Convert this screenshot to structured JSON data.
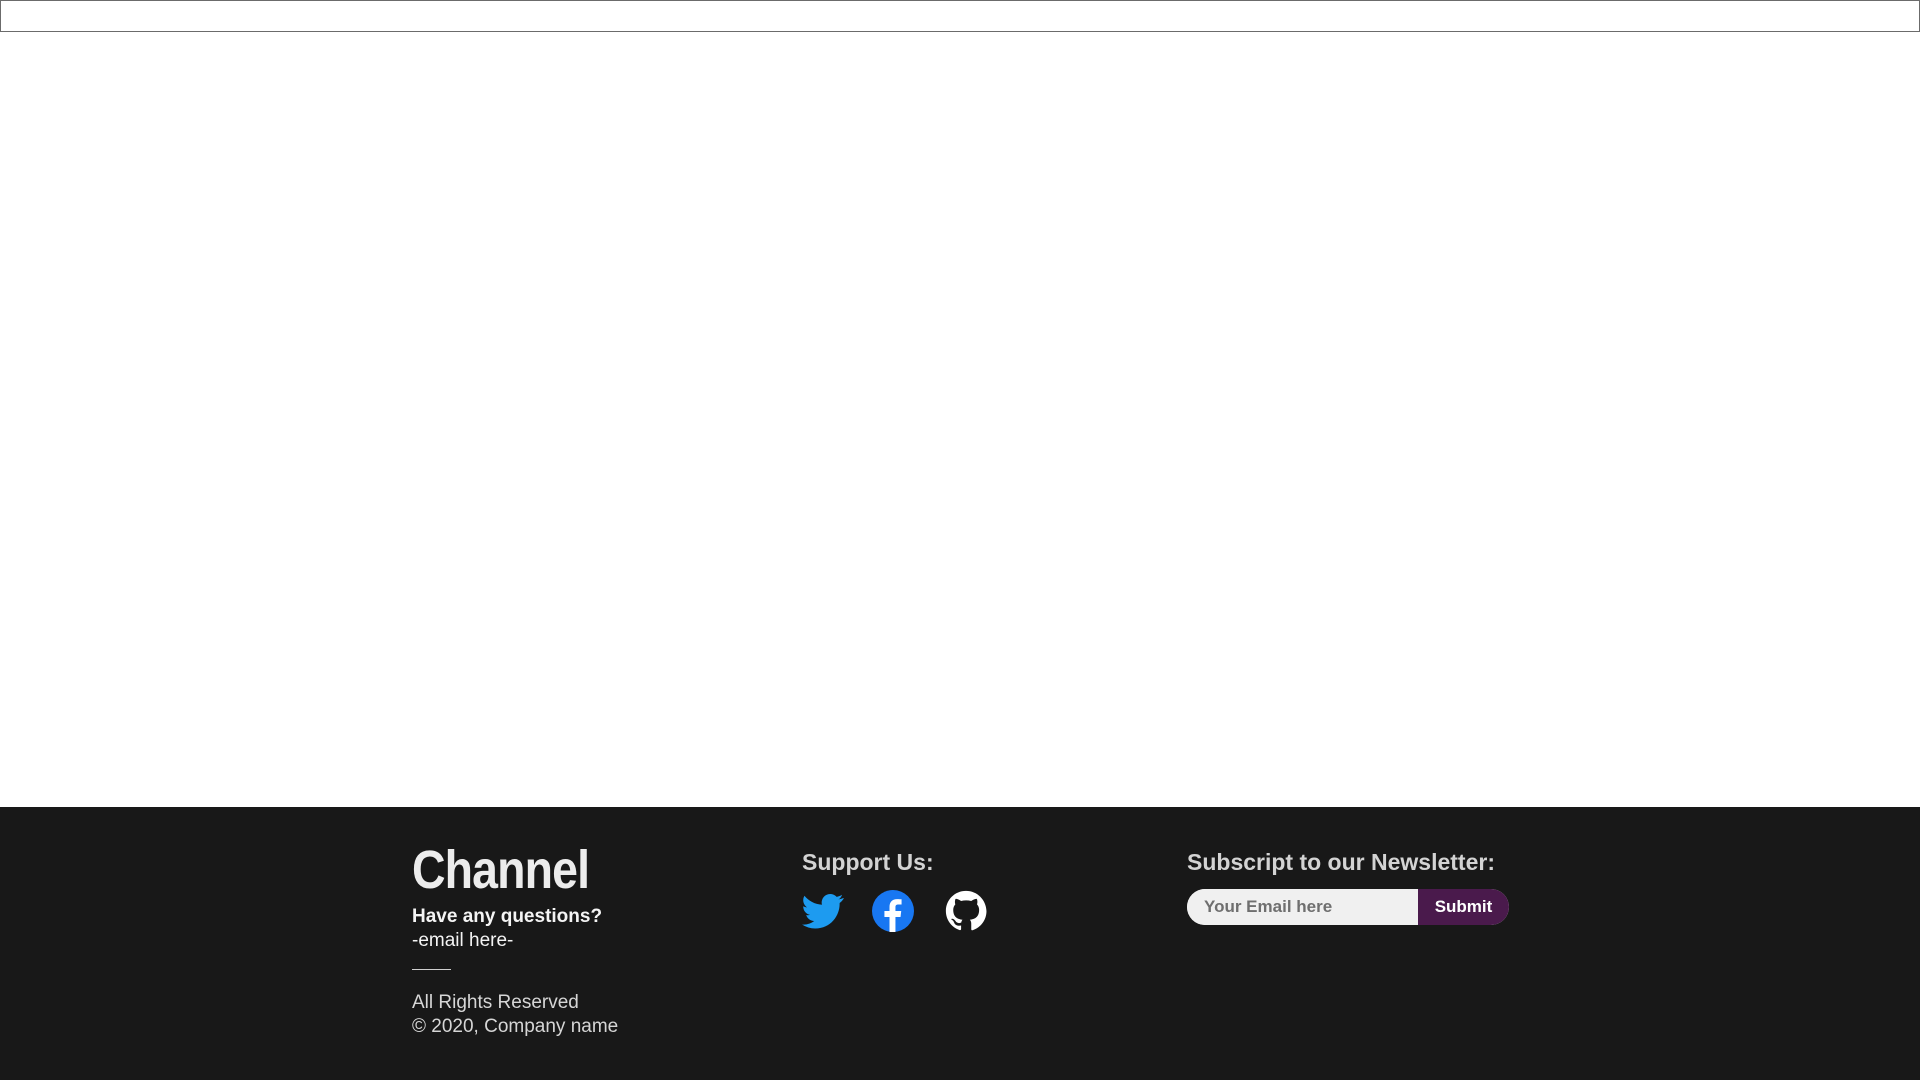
{
  "footer": {
    "brand": {
      "title": "Channel",
      "question": "Have any questions?",
      "email": "-email here-",
      "rights": "All Rights Reserved",
      "copyright": "© 2020, Company name"
    },
    "support": {
      "heading": "Support Us:",
      "links": [
        {
          "icon": "twitter-icon",
          "color": "#1d9bf0"
        },
        {
          "icon": "facebook-icon",
          "color": "#1877f2"
        },
        {
          "icon": "github-icon",
          "color": "#ffffff"
        }
      ]
    },
    "newsletter": {
      "heading": "Subscript to our Newsletter:",
      "email_placeholder": "Your Email here",
      "email_value": "",
      "submit_label": "Submit"
    }
  },
  "colors": {
    "footer_background": "#181818",
    "submit_background": "#4a1a4c",
    "input_background": "#f0f0f0",
    "heading_text": "#d3d3d3"
  }
}
